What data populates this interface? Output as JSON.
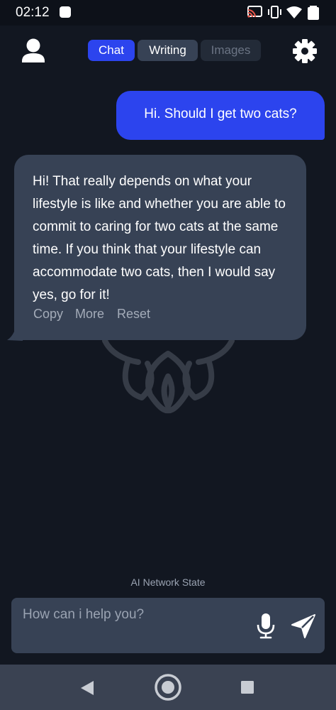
{
  "status_bar": {
    "time": "02:12"
  },
  "header": {
    "tabs": [
      {
        "label": "Chat",
        "state": "active"
      },
      {
        "label": "Writing",
        "state": "inactive"
      },
      {
        "label": "Images",
        "state": "disabled"
      }
    ],
    "icons": {
      "profile": "user-icon",
      "settings": "gear-icon"
    }
  },
  "conversation": {
    "user_message": "Hi. Should I get two cats?",
    "bot_message": "Hi! That really depends on what your lifestyle is like and whether you are able to commit to caring for two cats at the same time. If you think that your lifestyle can accommodate two cats, then I would say yes, go for it!",
    "actions": {
      "copy": "Copy",
      "more": "More",
      "reset": "Reset"
    }
  },
  "footer": {
    "network_state": "AI Network State",
    "input": {
      "placeholder": "How can i help you?",
      "value": ""
    },
    "icons": {
      "mic": "microphone-icon",
      "send": "send-icon"
    }
  },
  "colors": {
    "background": "#121721",
    "accent": "#2c44ee",
    "bubble": "#374255",
    "muted_text": "#a4acb9"
  }
}
